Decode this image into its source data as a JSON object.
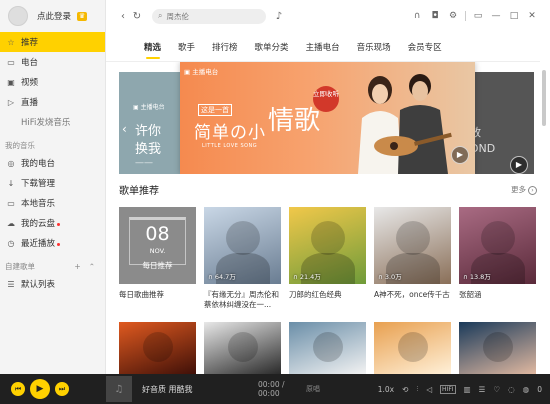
{
  "sidebar": {
    "login": "点此登录",
    "nav": [
      {
        "icon": "star-icon",
        "glyph": "☆",
        "label": "推荐",
        "active": true
      },
      {
        "icon": "radio-icon",
        "glyph": "▭",
        "label": "电台"
      },
      {
        "icon": "video-icon",
        "glyph": "▣",
        "label": "视频"
      },
      {
        "icon": "live-icon",
        "glyph": "▷",
        "label": "直播"
      },
      {
        "icon": "hifi-icon",
        "glyph": "",
        "label": "HiFi发烧音乐",
        "dim": true
      }
    ],
    "my_music_title": "我的音乐",
    "my_music": [
      {
        "icon": "location-icon",
        "glyph": "◎",
        "label": "我的电台"
      },
      {
        "icon": "download-icon",
        "glyph": "↓",
        "label": "下载管理"
      },
      {
        "icon": "local-music-icon",
        "glyph": "▭",
        "label": "本地音乐"
      },
      {
        "icon": "cloud-icon",
        "glyph": "☁",
        "label": "我的云盘",
        "dot": true
      },
      {
        "icon": "history-icon",
        "glyph": "◷",
        "label": "最近播放",
        "dot": true
      }
    ],
    "playlist_title": "自建歌单",
    "playlist_add": "+",
    "playlist_collapse": "⌃",
    "playlists": [
      {
        "icon": "list-icon",
        "glyph": "☰",
        "label": "默认列表"
      }
    ]
  },
  "topbar": {
    "back": "‹",
    "refresh": "↻",
    "search_icon": "⌕",
    "search_placeholder": "周杰伦",
    "voice": "♪",
    "headphones": "∩",
    "skin": "◘",
    "settings": "⚙",
    "mini": "▭",
    "minimize": "—",
    "maximize": "□",
    "close": "✕"
  },
  "tabs": [
    "精选",
    "歌手",
    "排行榜",
    "歌单分类",
    "主播电台",
    "音乐现场",
    "会员专区"
  ],
  "banner": {
    "left_tag": "▣ 主播电台",
    "left_line1": "许你",
    "left_line2": "换我",
    "left_line3": "——",
    "main_tag": "▣ 主播电台",
    "main_badge": "这是一首",
    "main_title": "简单の小",
    "main_big": "情歌",
    "main_sub": "LITTLE LOVE SONG",
    "listen": "立即收听",
    "right_line1": "放",
    "right_line2": "DND",
    "play": "▶",
    "prev": "‹"
  },
  "section": {
    "title": "歌单推荐",
    "more": "更多",
    "more_icon": "›"
  },
  "cards": [
    {
      "daily": true,
      "day": "08",
      "mon": "NOV.",
      "lbl": "每日推荐",
      "caption": "每日歌曲推荐"
    },
    {
      "caption": "『有缘无分』周杰伦和蔡依林纠缠没在一...",
      "count": "64.7万",
      "colors": [
        "#c9d7e6",
        "#6a7d92"
      ]
    },
    {
      "caption": "刀郎的红色经典",
      "count": "21.4万",
      "colors": [
        "#f1c84a",
        "#6f9b3a"
      ]
    },
    {
      "caption": "A神不死，once传千古",
      "count": "3.0万",
      "colors": [
        "#e8e8e8",
        "#8a6f58"
      ]
    },
    {
      "caption": "张韶涵",
      "count": "13.8万",
      "colors": [
        "#a96b83",
        "#5a2a3a"
      ]
    }
  ],
  "cards_row2": [
    {
      "colors": [
        "#e05a20",
        "#401008"
      ]
    },
    {
      "colors": [
        "#e8e8e8",
        "#2a2a2a"
      ]
    },
    {
      "colors": [
        "#6a8ea8",
        "#f2f2f2"
      ]
    },
    {
      "colors": [
        "#e8a050",
        "#fff0d8"
      ]
    },
    {
      "colors": [
        "#1a3a5a",
        "#e0b8a0"
      ]
    }
  ],
  "player": {
    "prev": "⏮",
    "play": "▶",
    "next": "⏭",
    "slogan": "好音质 用酷我",
    "time": "00:00 / 00:00",
    "vocal": "原唱",
    "speed": "1.0x",
    "loop": "⟲",
    "eq": "⫶",
    "volume": "◁",
    "hifi": "HIFI",
    "desklyric": "▥",
    "playlist": "☰",
    "lyric": "♡",
    "like": "◌",
    "comment": "◍",
    "count": "0"
  }
}
